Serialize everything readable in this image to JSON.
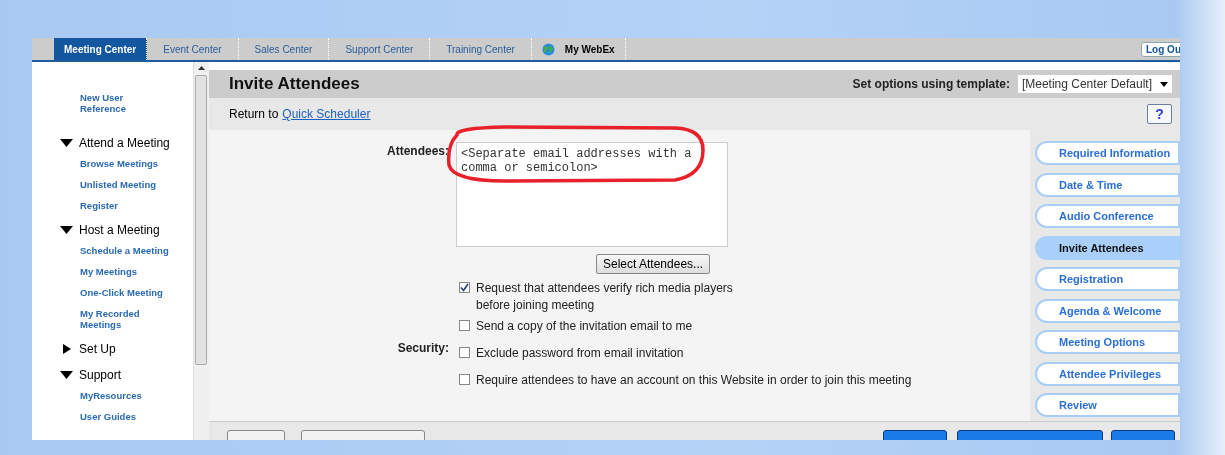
{
  "top_tabs": [
    {
      "label": "Meeting Center",
      "selected": true
    },
    {
      "label": "Event Center",
      "selected": false
    },
    {
      "label": "Sales Center",
      "selected": false
    },
    {
      "label": "Support Center",
      "selected": false
    },
    {
      "label": "Training Center",
      "selected": false
    },
    {
      "label": "My WebEx",
      "selected": false,
      "kind": "globe"
    }
  ],
  "logout": "Log Ou",
  "sidebar": {
    "top_link": "New User Reference",
    "sections": [
      {
        "title": "Attend a Meeting",
        "expanded": true,
        "items": [
          "Browse Meetings",
          "Unlisted Meeting",
          "Register"
        ]
      },
      {
        "title": "Host a Meeting",
        "expanded": true,
        "items": [
          "Schedule a Meeting",
          "My Meetings",
          "One-Click Meeting",
          "My Recorded Meetings"
        ]
      },
      {
        "title": "Set Up",
        "expanded": false
      },
      {
        "title": "Support",
        "expanded": true,
        "items": [
          "MyResources",
          "User Guides"
        ]
      }
    ]
  },
  "page_title": "Invite Attendees",
  "template": {
    "label": "Set options using template:",
    "value": "[Meeting Center Default]"
  },
  "return": {
    "prefix": "Return to",
    "link": "Quick Scheduler"
  },
  "help": "?",
  "attendees": {
    "label": "Attendees:",
    "placeholder": "<Separate email addresses with a comma or semicolon>",
    "button": "Select Attendees..."
  },
  "options": [
    {
      "label": "Request that attendees verify rich media players before joining meeting",
      "checked": true
    },
    {
      "label": "Send a copy of the invitation email to me",
      "checked": false
    },
    {
      "label": "Exclude password from email invitation",
      "checked": false,
      "group": "Security:"
    },
    {
      "label": "Require attendees to have an account on this Website in order to join this meeting",
      "checked": false
    }
  ],
  "steps": [
    {
      "label": "Required Information",
      "selected": false
    },
    {
      "label": "Date & Time",
      "selected": false
    },
    {
      "label": "Audio Conference",
      "selected": false
    },
    {
      "label": "Invite Attendees",
      "selected": true
    },
    {
      "label": "Registration",
      "selected": false
    },
    {
      "label": "Agenda & Welcome",
      "selected": false
    },
    {
      "label": "Meeting Options",
      "selected": false
    },
    {
      "label": "Attendee Privileges",
      "selected": false
    },
    {
      "label": "Review",
      "selected": false
    }
  ]
}
